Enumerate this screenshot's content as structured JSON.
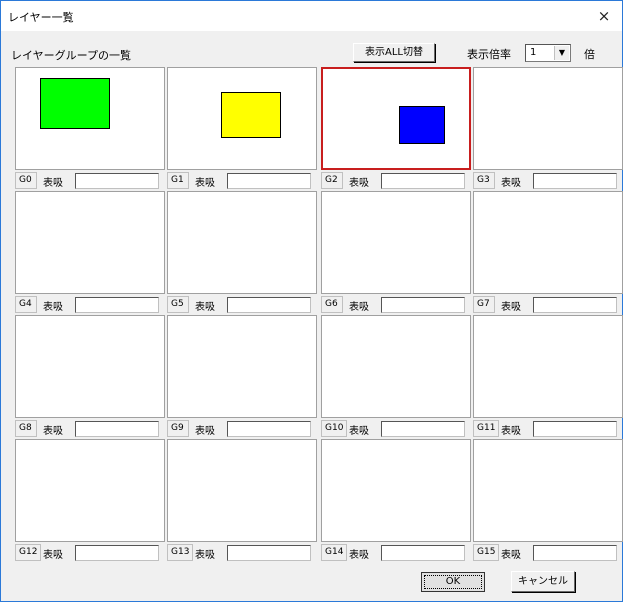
{
  "window": {
    "title": "レイヤー一覧",
    "close_glyph": "×"
  },
  "header": {
    "label": "レイヤーグループの一覧",
    "toggle_all_button": "表示ALL切替",
    "ratio_label": "表示倍率",
    "ratio_value": "1",
    "unit_label": "倍"
  },
  "groups": [
    {
      "name": "G0",
      "show_label": "表吸",
      "field_value": "",
      "swatch": "#00ff00"
    },
    {
      "name": "G1",
      "show_label": "表吸",
      "field_value": "",
      "swatch": "#ffff00"
    },
    {
      "name": "G2",
      "show_label": "表吸",
      "field_value": "",
      "swatch": "#0000ff",
      "selected": true
    },
    {
      "name": "G3",
      "show_label": "表吸",
      "field_value": ""
    },
    {
      "name": "G4",
      "show_label": "表吸",
      "field_value": ""
    },
    {
      "name": "G5",
      "show_label": "表吸",
      "field_value": ""
    },
    {
      "name": "G6",
      "show_label": "表吸",
      "field_value": ""
    },
    {
      "name": "G7",
      "show_label": "表吸",
      "field_value": ""
    },
    {
      "name": "G8",
      "show_label": "表吸",
      "field_value": ""
    },
    {
      "name": "G9",
      "show_label": "表吸",
      "field_value": ""
    },
    {
      "name": "G10",
      "show_label": "表吸",
      "field_value": ""
    },
    {
      "name": "G11",
      "show_label": "表吸",
      "field_value": ""
    },
    {
      "name": "G12",
      "show_label": "表吸",
      "field_value": ""
    },
    {
      "name": "G13",
      "show_label": "表吸",
      "field_value": ""
    },
    {
      "name": "G14",
      "show_label": "表吸",
      "field_value": ""
    },
    {
      "name": "G15",
      "show_label": "表吸",
      "field_value": ""
    }
  ],
  "footer": {
    "ok_button": "OK",
    "cancel_button": "キャンセル"
  },
  "colors": {
    "selected_border": "#c81e1e",
    "window_border": "#2b79d8"
  }
}
